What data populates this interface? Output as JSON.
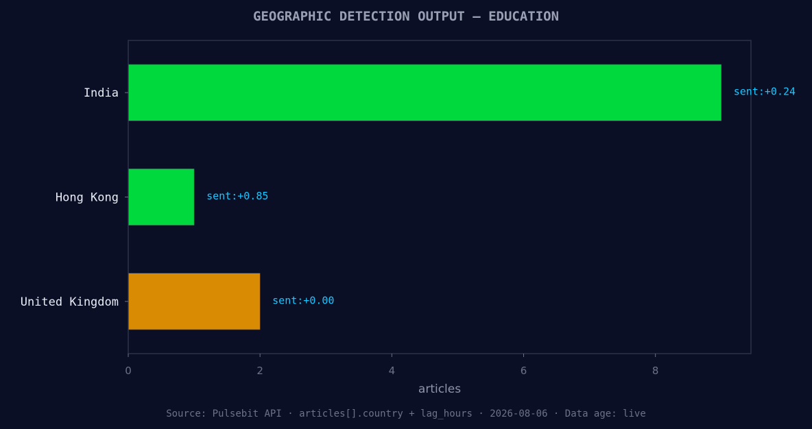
{
  "chart_data": {
    "type": "bar",
    "orientation": "horizontal",
    "title": "GEOGRAPHIC DETECTION OUTPUT — EDUCATION",
    "xlabel": "articles",
    "ylabel": "",
    "categories": [
      "India",
      "Hong Kong",
      "United Kingdom"
    ],
    "values": [
      9,
      1,
      2
    ],
    "data_labels": [
      "sent:+0.24",
      "sent:+0.85",
      "sent:+0.00"
    ],
    "bar_colors": [
      "#00d93e",
      "#00d93e",
      "#d98c03"
    ],
    "xlim": [
      0,
      9.45
    ],
    "xticks": [
      0,
      2,
      4,
      6,
      8
    ],
    "grid": false,
    "source": "Source: Pulsebit API · articles[].country + lag_hours · 2026-08-06 · Data age: live"
  },
  "colors": {
    "background": "#0b0f26",
    "frame": "#2c3148",
    "positive": "#00d93e",
    "neutral": "#d98c03",
    "label_accent": "#19c7ff"
  }
}
